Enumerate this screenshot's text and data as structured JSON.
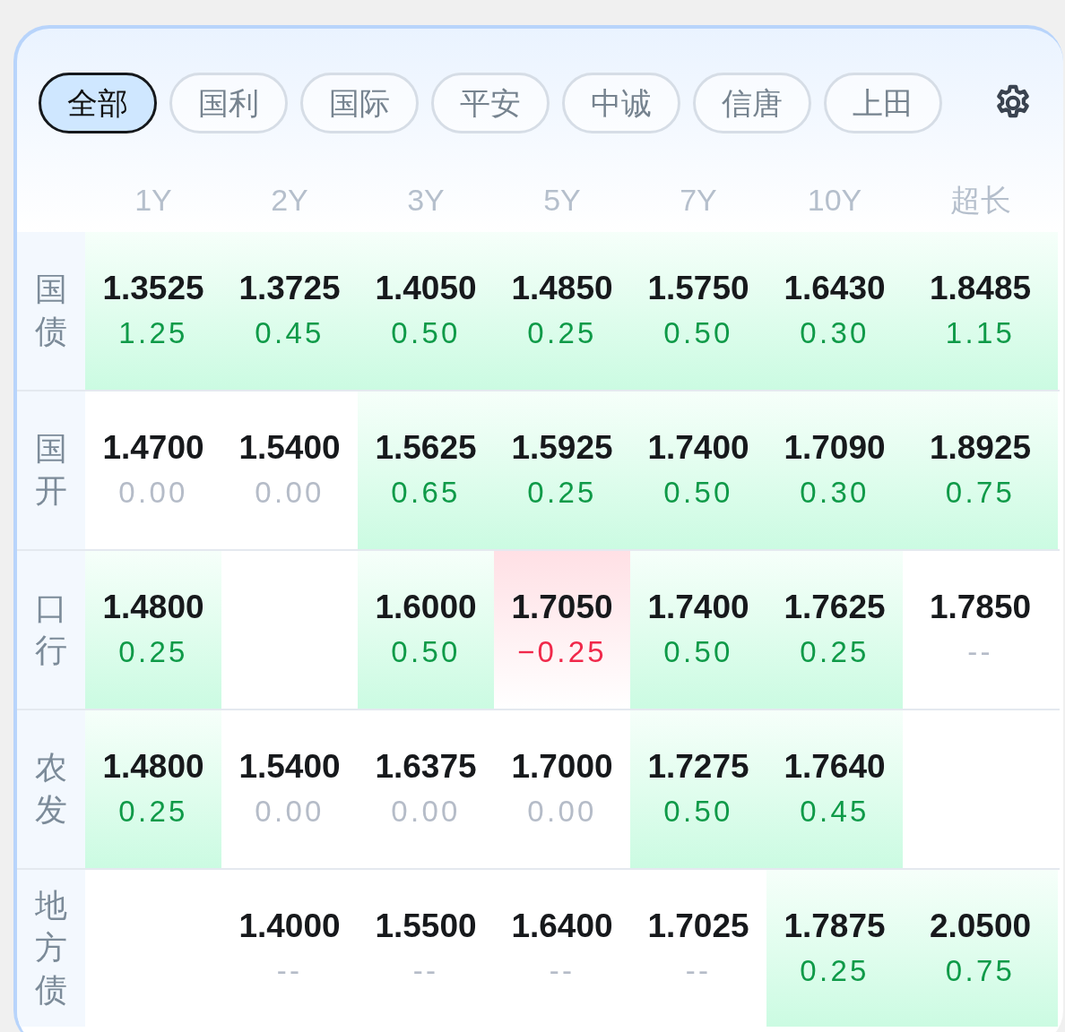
{
  "filters": [
    {
      "label": "全部",
      "selected": true
    },
    {
      "label": "国利",
      "selected": false
    },
    {
      "label": "国际",
      "selected": false
    },
    {
      "label": "平安",
      "selected": false
    },
    {
      "label": "中诚",
      "selected": false
    },
    {
      "label": "信唐",
      "selected": false
    },
    {
      "label": "上田",
      "selected": false
    }
  ],
  "columns": [
    "1Y",
    "2Y",
    "3Y",
    "5Y",
    "7Y",
    "10Y",
    "超长"
  ],
  "rows": [
    {
      "label": "国债",
      "cells": [
        {
          "kind": "up",
          "rate": "1.3525",
          "change": "1.25"
        },
        {
          "kind": "up",
          "rate": "1.3725",
          "change": "0.45"
        },
        {
          "kind": "up",
          "rate": "1.4050",
          "change": "0.50"
        },
        {
          "kind": "up",
          "rate": "1.4850",
          "change": "0.25"
        },
        {
          "kind": "up",
          "rate": "1.5750",
          "change": "0.50"
        },
        {
          "kind": "up",
          "rate": "1.6430",
          "change": "0.30"
        },
        {
          "kind": "up",
          "rate": "1.8485",
          "change": "1.15"
        }
      ]
    },
    {
      "label": "国开",
      "cells": [
        {
          "kind": "flat",
          "rate": "1.4700",
          "change": "0.00"
        },
        {
          "kind": "flat",
          "rate": "1.5400",
          "change": "0.00"
        },
        {
          "kind": "up",
          "rate": "1.5625",
          "change": "0.65"
        },
        {
          "kind": "up",
          "rate": "1.5925",
          "change": "0.25"
        },
        {
          "kind": "up",
          "rate": "1.7400",
          "change": "0.50"
        },
        {
          "kind": "up",
          "rate": "1.7090",
          "change": "0.30"
        },
        {
          "kind": "up",
          "rate": "1.8925",
          "change": "0.75"
        }
      ]
    },
    {
      "label": "口行",
      "cells": [
        {
          "kind": "up",
          "rate": "1.4800",
          "change": "0.25"
        },
        {
          "kind": "empty"
        },
        {
          "kind": "up",
          "rate": "1.6000",
          "change": "0.50"
        },
        {
          "kind": "down",
          "rate": "1.7050",
          "change": "−0.25"
        },
        {
          "kind": "up",
          "rate": "1.7400",
          "change": "0.50"
        },
        {
          "kind": "up",
          "rate": "1.7625",
          "change": "0.25"
        },
        {
          "kind": "flat",
          "rate": "1.7850",
          "change": "--"
        }
      ]
    },
    {
      "label": "农发",
      "cells": [
        {
          "kind": "up",
          "rate": "1.4800",
          "change": "0.25"
        },
        {
          "kind": "flat",
          "rate": "1.5400",
          "change": "0.00"
        },
        {
          "kind": "flat",
          "rate": "1.6375",
          "change": "0.00"
        },
        {
          "kind": "flat",
          "rate": "1.7000",
          "change": "0.00"
        },
        {
          "kind": "up",
          "rate": "1.7275",
          "change": "0.50"
        },
        {
          "kind": "up",
          "rate": "1.7640",
          "change": "0.45"
        },
        {
          "kind": "empty"
        }
      ]
    },
    {
      "label": "地方债",
      "cells": [
        {
          "kind": "empty"
        },
        {
          "kind": "flat",
          "rate": "1.4000",
          "change": "--"
        },
        {
          "kind": "flat",
          "rate": "1.5500",
          "change": "--"
        },
        {
          "kind": "flat",
          "rate": "1.6400",
          "change": "--"
        },
        {
          "kind": "flat",
          "rate": "1.7025",
          "change": "--"
        },
        {
          "kind": "up",
          "rate": "1.7875",
          "change": "0.25"
        },
        {
          "kind": "up",
          "rate": "2.0500",
          "change": "0.75"
        }
      ]
    }
  ]
}
